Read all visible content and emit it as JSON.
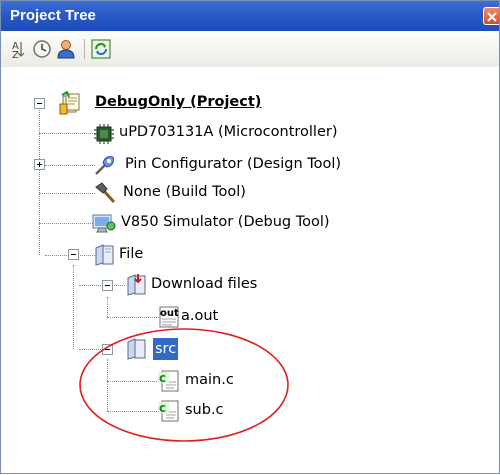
{
  "panel": {
    "title": "Project Tree"
  },
  "toolbar": {
    "buttons": [
      {
        "name": "sort-icon"
      },
      {
        "name": "clock-icon"
      },
      {
        "name": "user-icon"
      },
      {
        "name": "refresh-icon"
      }
    ]
  },
  "tree": {
    "project": "DebugOnly (Project)",
    "microcontroller": "uPD703131A (Microcontroller)",
    "pin_configurator": "Pin Configurator (Design Tool)",
    "build_tool": "None (Build Tool)",
    "debug_tool": "V850 Simulator (Debug Tool)",
    "file_node": "File",
    "download_files": "Download files",
    "a_out": "a.out",
    "src": "src",
    "main_c": "main.c",
    "sub_c": "sub.c"
  },
  "icon_text": {
    "out_label": "out",
    "c_label": "c"
  },
  "colors": {
    "selection": "#316ac5",
    "titlebar": "#2a5bc8",
    "annotation": "#e02020"
  }
}
